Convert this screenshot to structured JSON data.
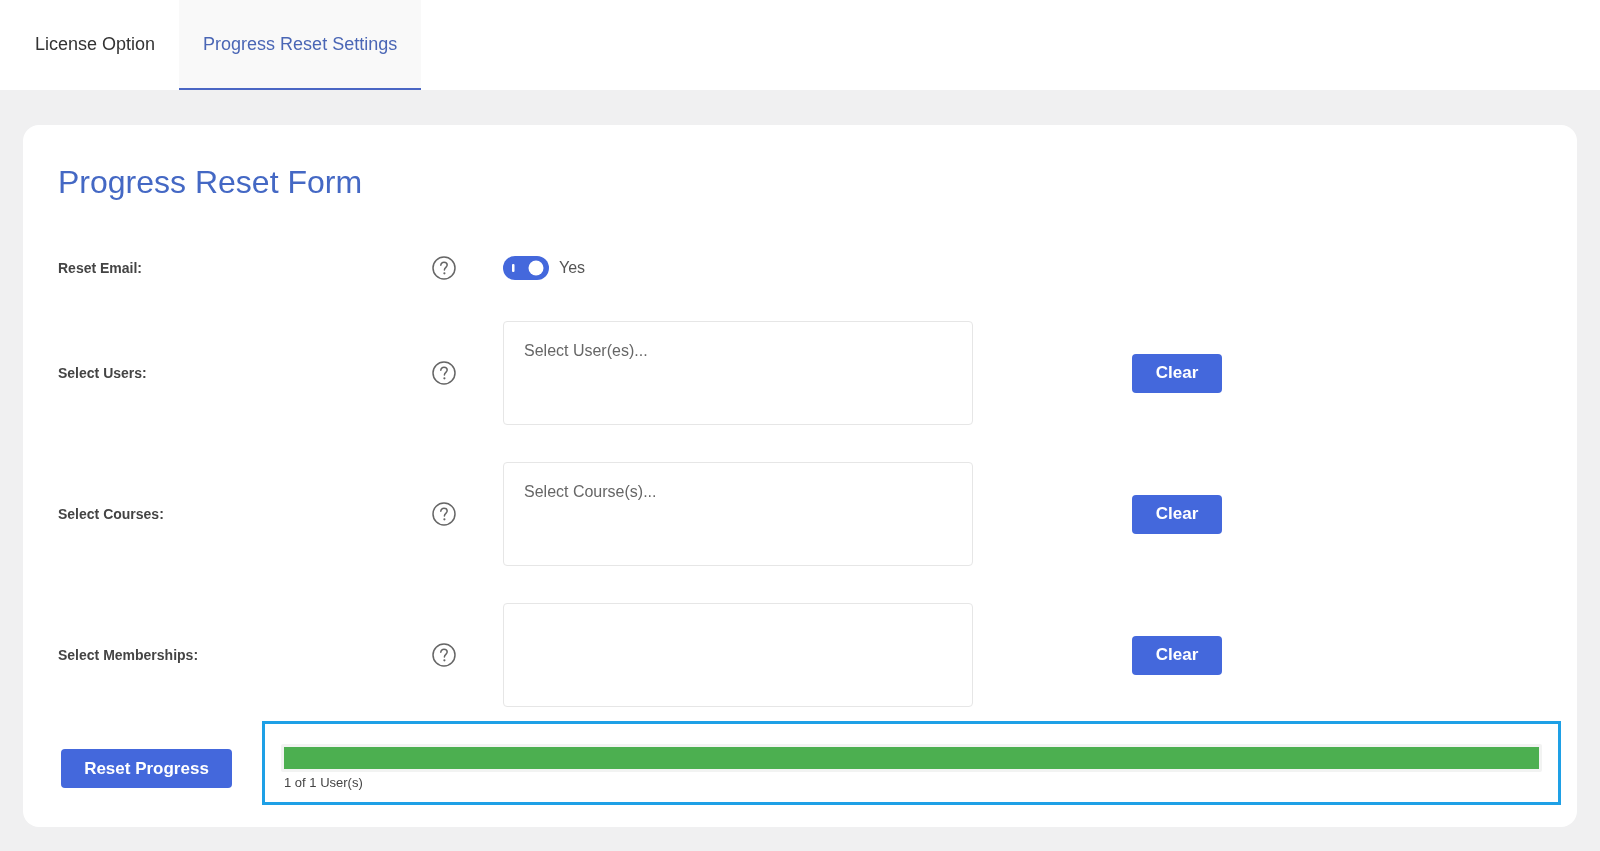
{
  "tabs": [
    {
      "label": "License Option",
      "selected": false
    },
    {
      "label": "Progress Reset Settings",
      "selected": true
    }
  ],
  "form": {
    "title": "Progress Reset Form",
    "rows": [
      {
        "kind": "toggle",
        "label": "Reset Email:",
        "on": true,
        "text": "Yes"
      },
      {
        "kind": "select",
        "label": "Select Users:",
        "placeholder": "Select User(es)...",
        "button": "Clear"
      },
      {
        "kind": "select",
        "label": "Select Courses:",
        "placeholder": "Select Course(s)...",
        "button": "Clear"
      },
      {
        "kind": "select",
        "label": "Select Memberships:",
        "button": "Clear"
      }
    ],
    "reset_button": "Reset Progress",
    "progress": {
      "highlighted": true,
      "level": 1,
      "text": "1 of 1 User(s)"
    }
  }
}
